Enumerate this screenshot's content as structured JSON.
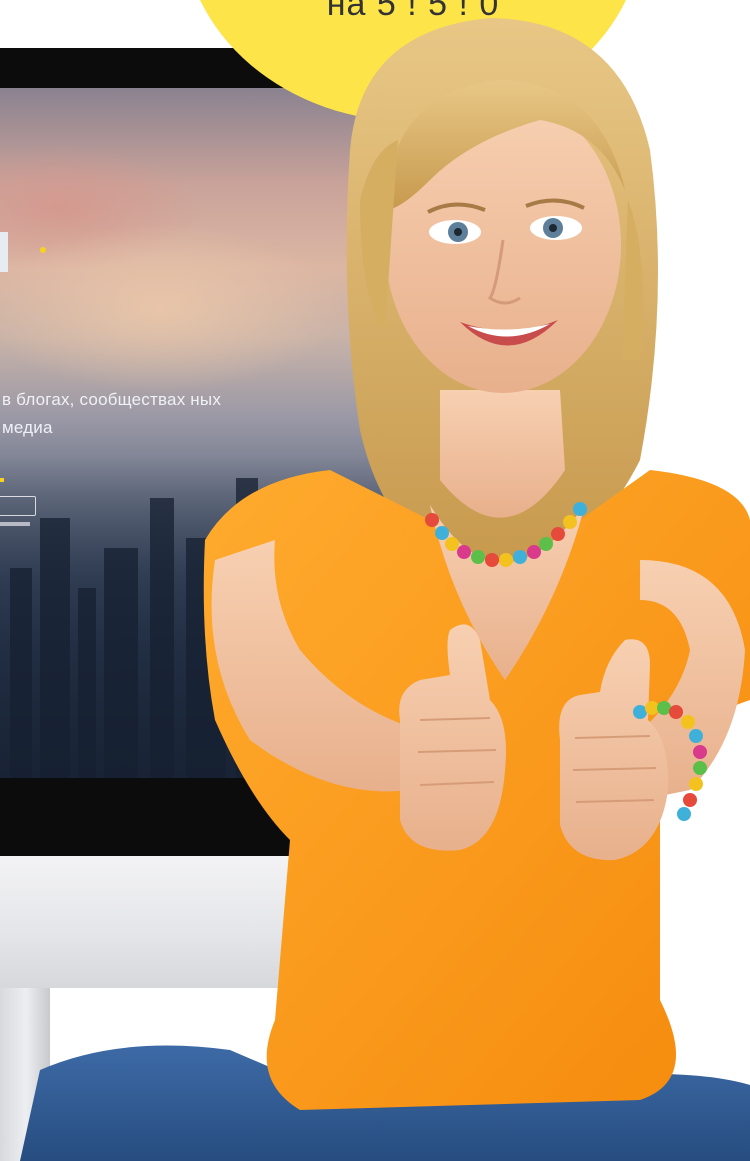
{
  "badge": {
    "text": "на 5 ! 5 ! 0"
  },
  "screen": {
    "headline": "в блогах, сообществах ных медиа",
    "logo_caption": "",
    "button_label": "",
    "background_theme": "blurred-city-skyline-at-sunset"
  },
  "colors": {
    "badge": "#fde449",
    "shirt": "#ff9a1a",
    "jeans": "#2f5d97",
    "hair": "#d9b46a",
    "skin": "#f2c3a2",
    "screen_accent": "#f7d21f"
  },
  "icons": [
    "star-dot-icon"
  ]
}
